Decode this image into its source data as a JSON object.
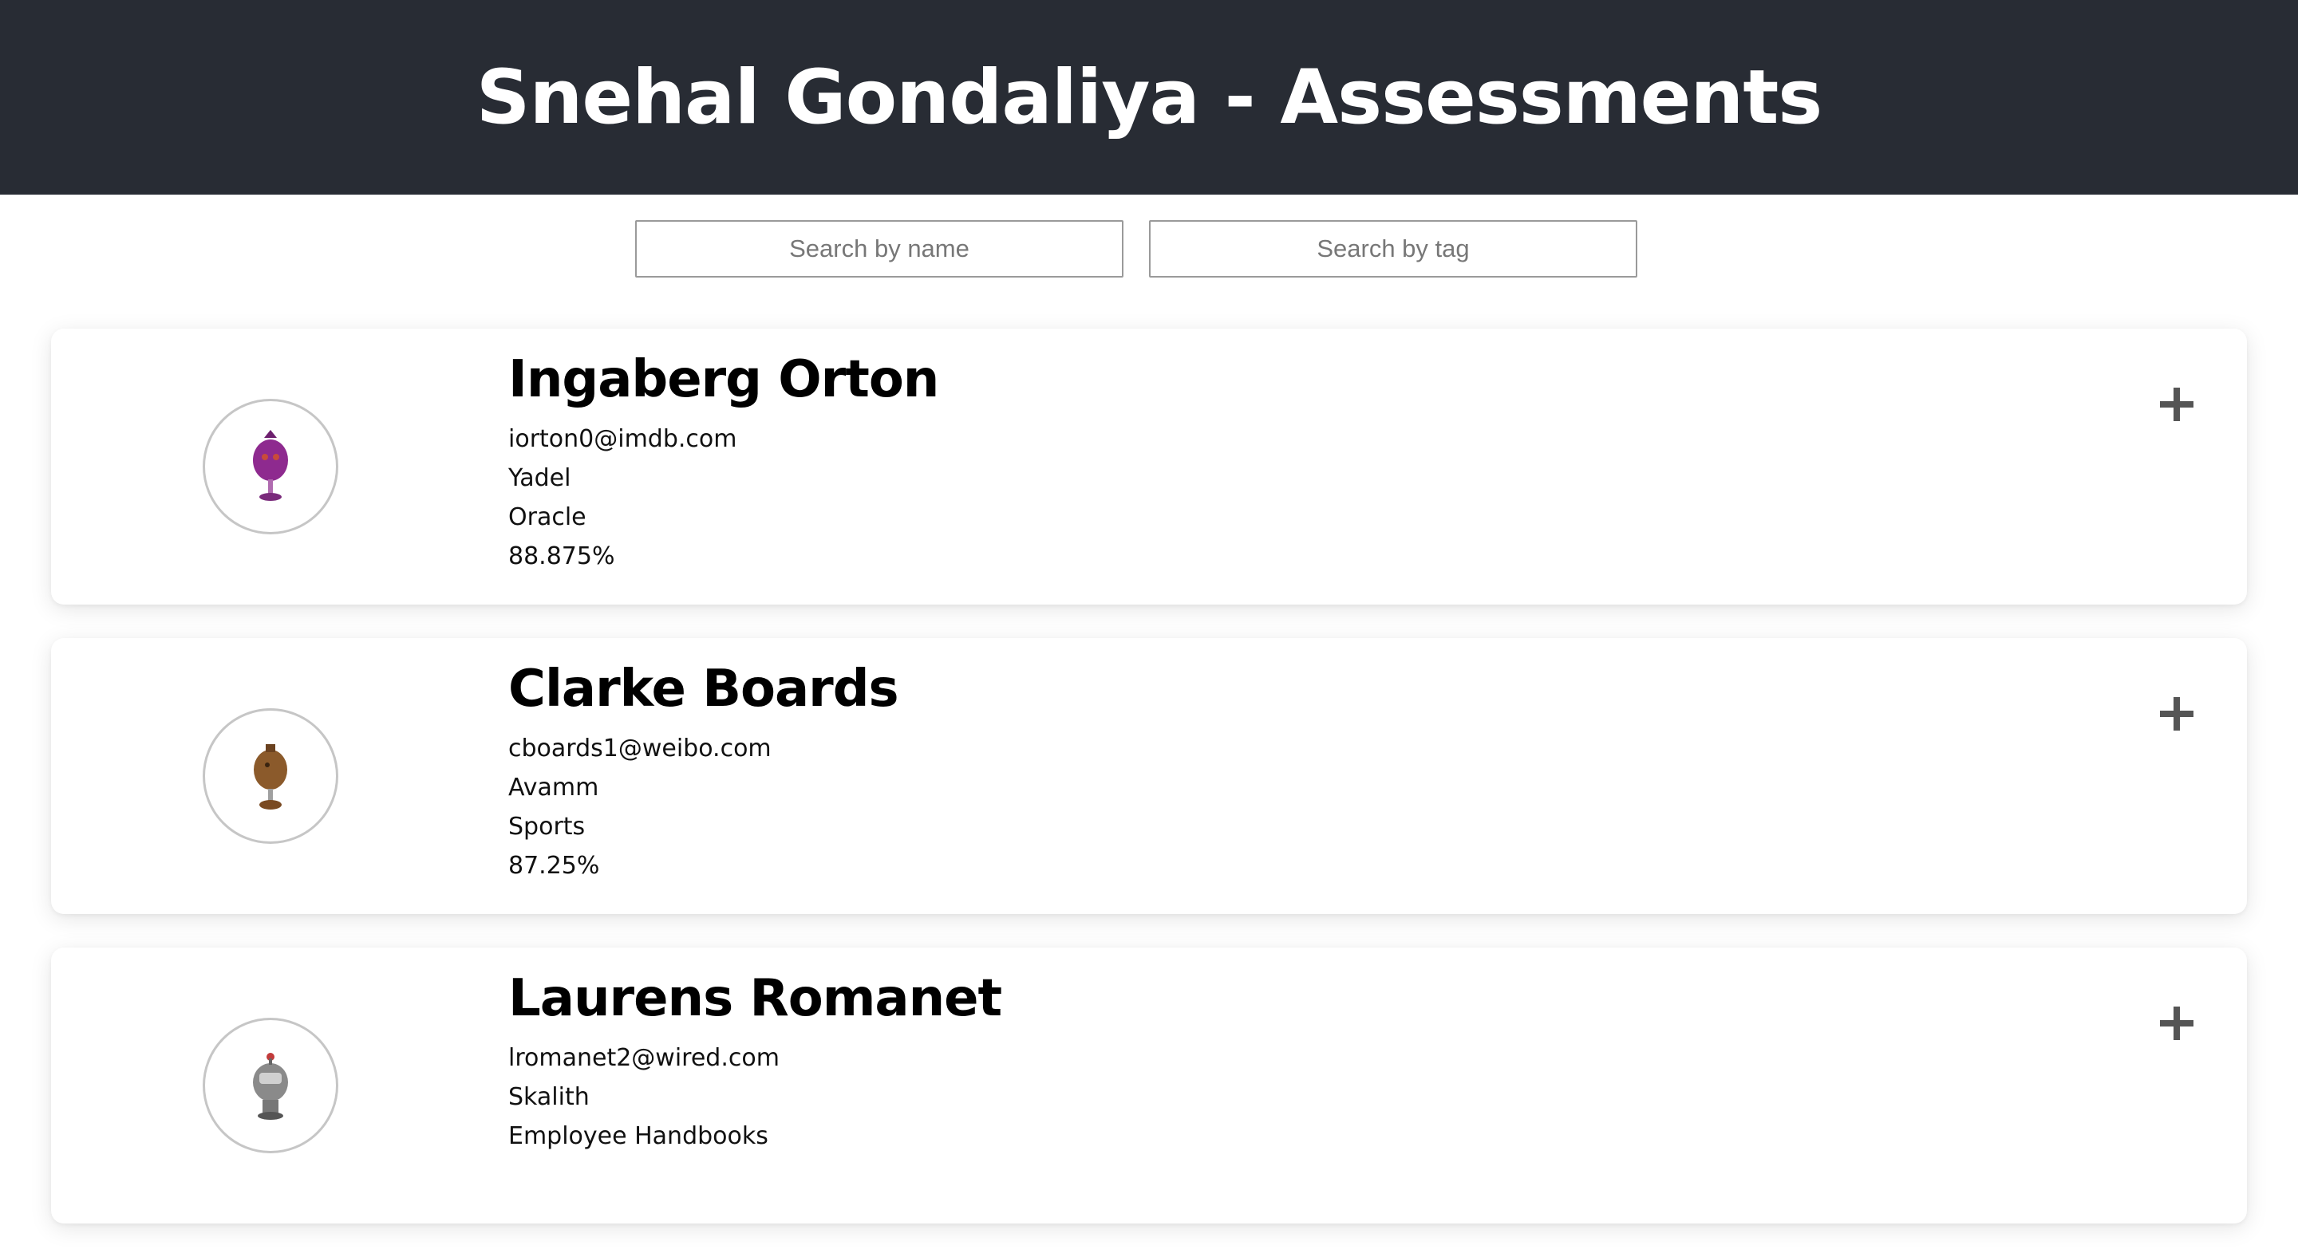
{
  "header": {
    "title": "Snehal Gondaliya - Assessments"
  },
  "search": {
    "name_placeholder": "Search by name",
    "tag_placeholder": "Search by tag"
  },
  "students": [
    {
      "name": "Ingaberg Orton",
      "email": "iorton0@imdb.com",
      "company": "Yadel",
      "skill": "Oracle",
      "average": "88.875%",
      "avatar_icon": "purple-robot-icon",
      "avatar_color": "#8e2a8f"
    },
    {
      "name": "Clarke Boards",
      "email": "cboards1@weibo.com",
      "company": "Avamm",
      "skill": "Sports",
      "average": "87.25%",
      "avatar_icon": "brown-robot-icon",
      "avatar_color": "#8b5a2b"
    },
    {
      "name": "Laurens Romanet",
      "email": "lromanet2@wired.com",
      "company": "Skalith",
      "skill": "Employee Handbooks",
      "average": "",
      "avatar_icon": "gray-robot-icon",
      "avatar_color": "#8a8a8a"
    }
  ],
  "colors": {
    "header_bg": "#282c34",
    "header_text": "#ffffff",
    "expand_icon": "#555555"
  },
  "icons": {
    "expand": "plus-icon"
  }
}
